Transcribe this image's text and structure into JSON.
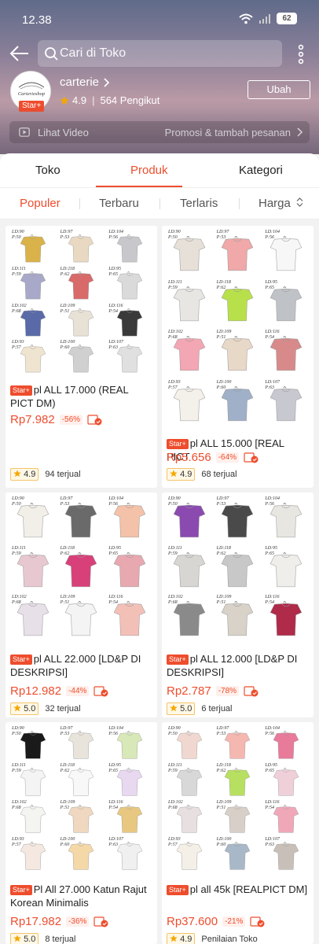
{
  "status": {
    "time": "12.38",
    "battery": "62"
  },
  "search": {
    "placeholder": "Cari di Toko"
  },
  "shop": {
    "name": "carterie",
    "badge": "Star+",
    "rating": "4.9",
    "followers": "564 Pengikut",
    "edit_label": "Ubah",
    "logo_text": "Carterieshop"
  },
  "video": {
    "label": "Lihat Video",
    "promo": "Promosi & tambah pesanan"
  },
  "tabs": [
    {
      "label": "Toko"
    },
    {
      "label": "Produk"
    },
    {
      "label": "Kategori"
    }
  ],
  "sort": [
    {
      "label": "Populer"
    },
    {
      "label": "Terbaru"
    },
    {
      "label": "Terlaris"
    },
    {
      "label": "Harga"
    }
  ],
  "products": [
    {
      "badge": "Star+",
      "title": "pl ALL 17.000 (REAL PICT DM)",
      "price": "Rp7.982",
      "discount": "-56%",
      "rating": "4.9",
      "sold": "94 terjual"
    },
    {
      "badge": "Star+",
      "title": "pl ALL 15.000 [REAL PICT",
      "price": "Rp5.656",
      "discount": "-64%",
      "rating": "4.9",
      "sold": "68 terjual"
    },
    {
      "badge": "Star+",
      "title": "pl ALL 22.000 [LD&P DI DESKRIPSI]",
      "price": "Rp12.982",
      "discount": "-44%",
      "rating": "5.0",
      "sold": "32 terjual"
    },
    {
      "badge": "Star+",
      "title": "pl ALL 12.000 [LD&P DI DESKRIPSI]",
      "price": "Rp2.787",
      "discount": "-78%",
      "rating": "5.0",
      "sold": "6 terjual"
    },
    {
      "badge": "Star+",
      "title": "Pl All 27.000 Katun Rajut Korean Minimalis",
      "price": "Rp17.982",
      "discount": "-36%",
      "rating": "5.0",
      "sold": "8 terjual"
    },
    {
      "badge": "Star+",
      "title": "pl all 45k [REALPICT DM]",
      "price": "Rp37.600",
      "discount": "-21%",
      "rating": "4.9",
      "sold": "Penilaian Toko"
    }
  ],
  "colors": {
    "accent": "#ee4d2d",
    "star": "#f6a700"
  }
}
